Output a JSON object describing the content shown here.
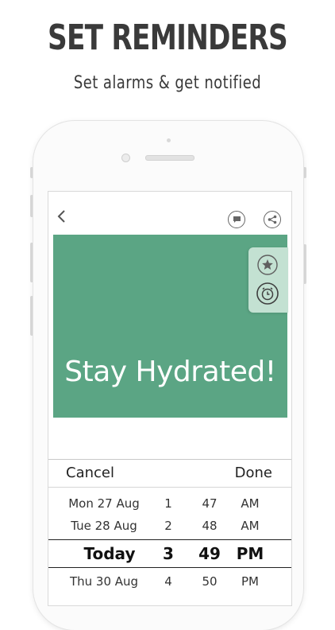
{
  "headline": "SET REMINDERS",
  "subheadline": "Set alarms &  get notified",
  "screen": {
    "toolbar": {
      "back_icon": "chevron-left-icon",
      "comment_icon": "chat-bubble-icon",
      "share_icon": "share-icon"
    },
    "card": {
      "text": "Stay Hydrated!",
      "background_color": "#5ba584",
      "actions": [
        "star-icon",
        "alarm-clock-icon"
      ]
    },
    "picker": {
      "cancel_label": "Cancel",
      "done_label": "Done",
      "rows": [
        {
          "date": "Mon 27 Aug",
          "hour": "1",
          "minute": "47",
          "ampm": "AM"
        },
        {
          "date": "Tue 28 Aug",
          "hour": "2",
          "minute": "48",
          "ampm": "AM"
        },
        {
          "date": "Today",
          "hour": "3",
          "minute": "49",
          "ampm": "PM"
        },
        {
          "date": "Thu 30 Aug",
          "hour": "4",
          "minute": "50",
          "ampm": "PM"
        }
      ],
      "selected_index": 2
    }
  }
}
